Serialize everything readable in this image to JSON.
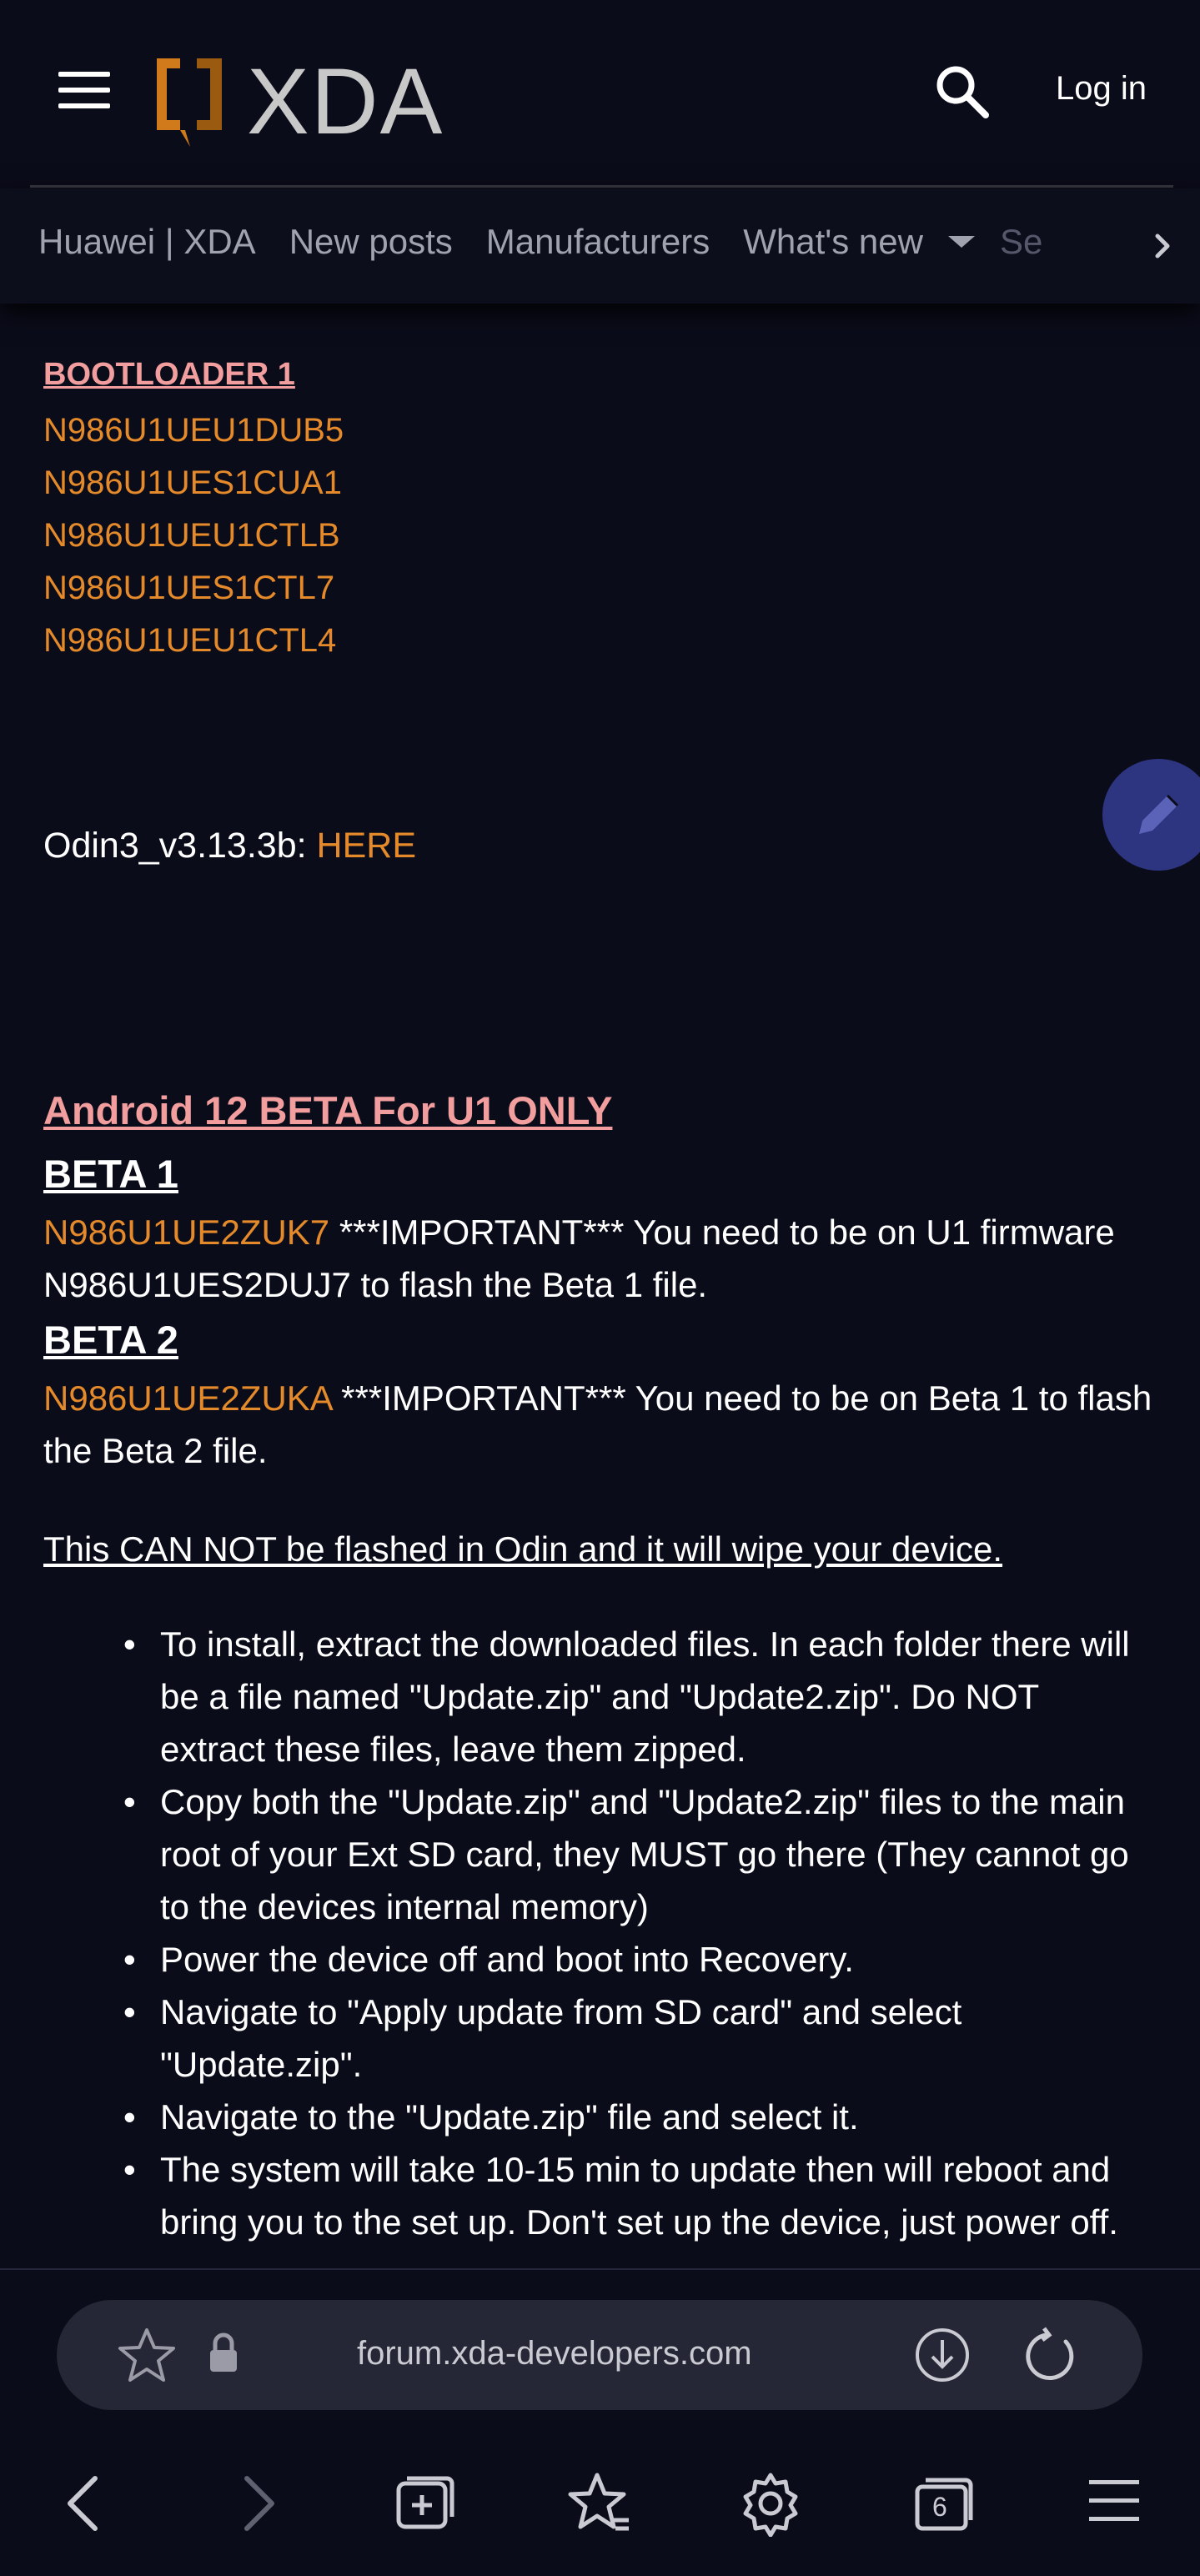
{
  "header": {
    "logo_text": "XDA",
    "login_label": "Log in",
    "icons": [
      "hamburger-menu-icon",
      "search-icon"
    ]
  },
  "nav": {
    "items": [
      {
        "label": "Huawei | XDA"
      },
      {
        "label": "New posts"
      },
      {
        "label": "Manufacturers"
      },
      {
        "label": "What's new"
      },
      {
        "label": "Se"
      }
    ]
  },
  "post": {
    "bootloader_heading": "BOOTLOADER 1",
    "firmware_links": [
      "N986U1UEU1DUB5",
      "N986U1UES1CUA1",
      "N986U1UEU1CTLB",
      "N986U1UES1CTL7",
      "N986U1UEU1CTL4"
    ],
    "odin_label": "Odin3_v3.13.3b:",
    "odin_link": "HERE",
    "android12_heading": "Android 12 BETA For U1 ONLY",
    "beta1": {
      "title": "BETA 1",
      "link": "N986U1UE2ZUK7",
      "text": " ***IMPORTANT*** You need to be on U1 firmware N986U1UES2DUJ7 to flash the Beta 1 file."
    },
    "beta2": {
      "title": "BETA 2",
      "link": "N986U1UE2ZUKA",
      "text": " ***IMPORTANT*** You need to be on Beta 1 to flash the Beta 2 file."
    },
    "warning": "This CAN NOT be flashed in Odin and it will wipe your device.",
    "steps": [
      "To install, extract the downloaded files. In each folder there will be a file named \"Update.zip\" and \"Update2.zip\". Do NOT extract these files, leave them zipped.",
      "Copy both the \"Update.zip\" and \"Update2.zip\" files to the main root of your Ext SD card, they MUST go there (They cannot go to the devices internal memory)",
      "Power the device off and boot into Recovery.",
      "Navigate to \"Apply update from SD card\" and select \"Update.zip\".",
      "Navigate to the \"Update.zip\" file and select it.",
      "The system will take 10-15 min to update then will reboot and bring you to the set up. Don't set up the device, just power off."
    ]
  },
  "browser": {
    "url": "forum.xda-developers.com",
    "tab_count": "6"
  },
  "colors": {
    "background": "#0b0c1a",
    "link_orange": "#e58a2a",
    "heading_pink": "#f29e9e",
    "fab_blue": "#2d3480"
  }
}
